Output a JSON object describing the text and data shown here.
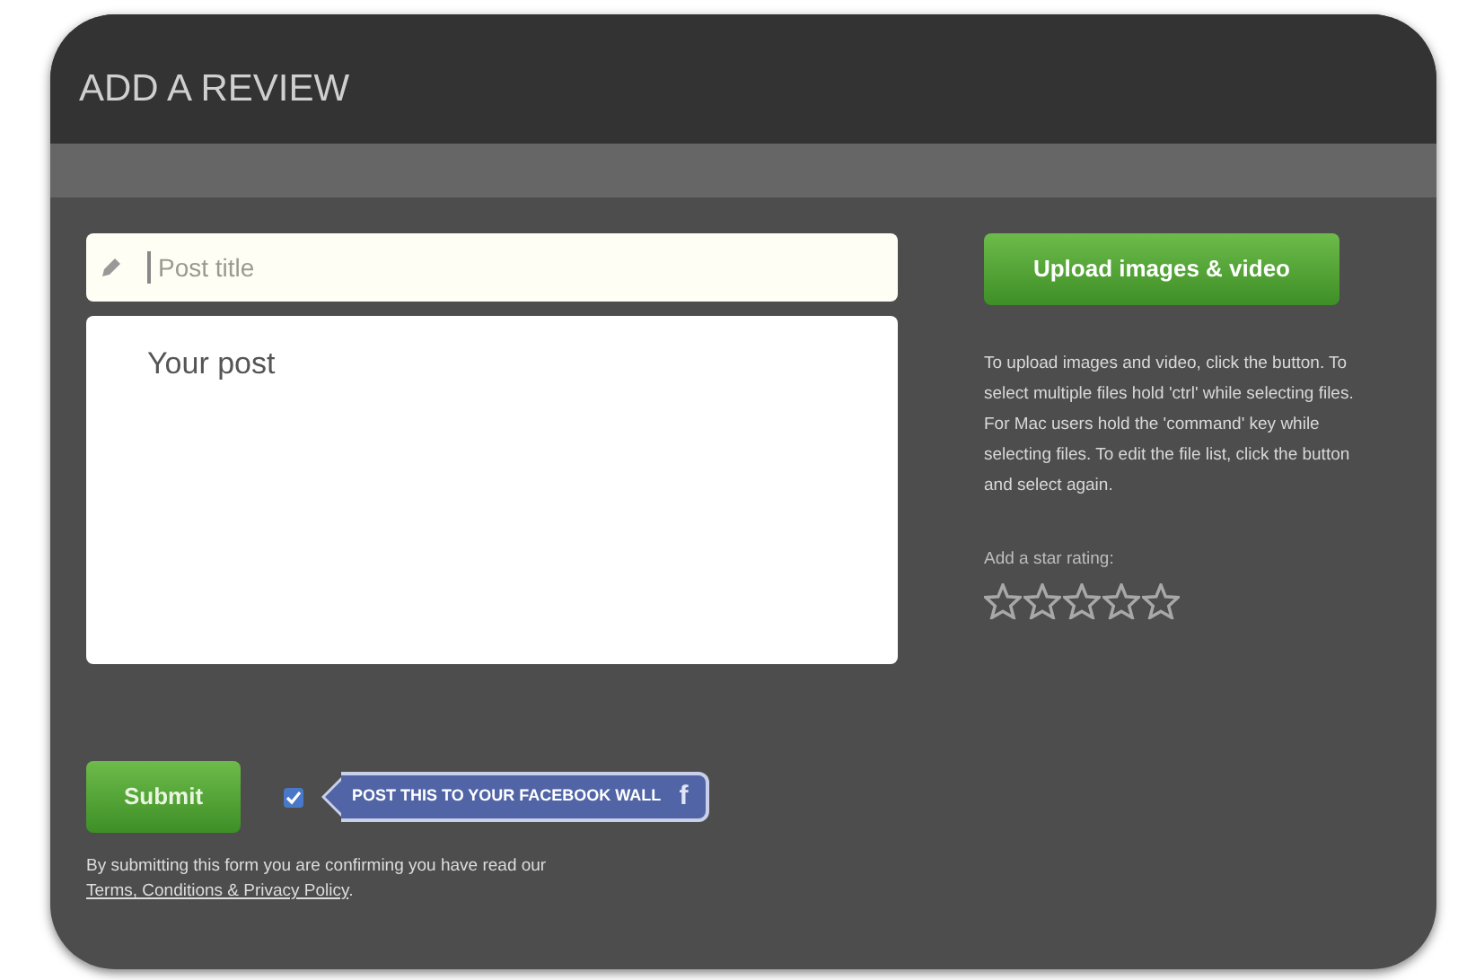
{
  "header": {
    "title": "ADD A REVIEW"
  },
  "form": {
    "title_placeholder": "Post title",
    "post_placeholder": "Your post"
  },
  "upload": {
    "button": "Upload images & video",
    "help": "To upload images and video, click the button. To select multiple files hold 'ctrl' while selecting files. For Mac users hold the 'command' key while selecting files. To edit the file list, click the button and select again."
  },
  "rating": {
    "label": "Add a star rating:",
    "stars": 0
  },
  "submit": {
    "button": "Submit"
  },
  "facebook": {
    "checked": true,
    "label": "POST THIS TO YOUR FACEBOOK WALL",
    "icon": "f"
  },
  "footer": {
    "text": "By submitting this form you are confirming you have read our",
    "link": "Terms, Conditions & Privacy Policy",
    "after": "."
  }
}
